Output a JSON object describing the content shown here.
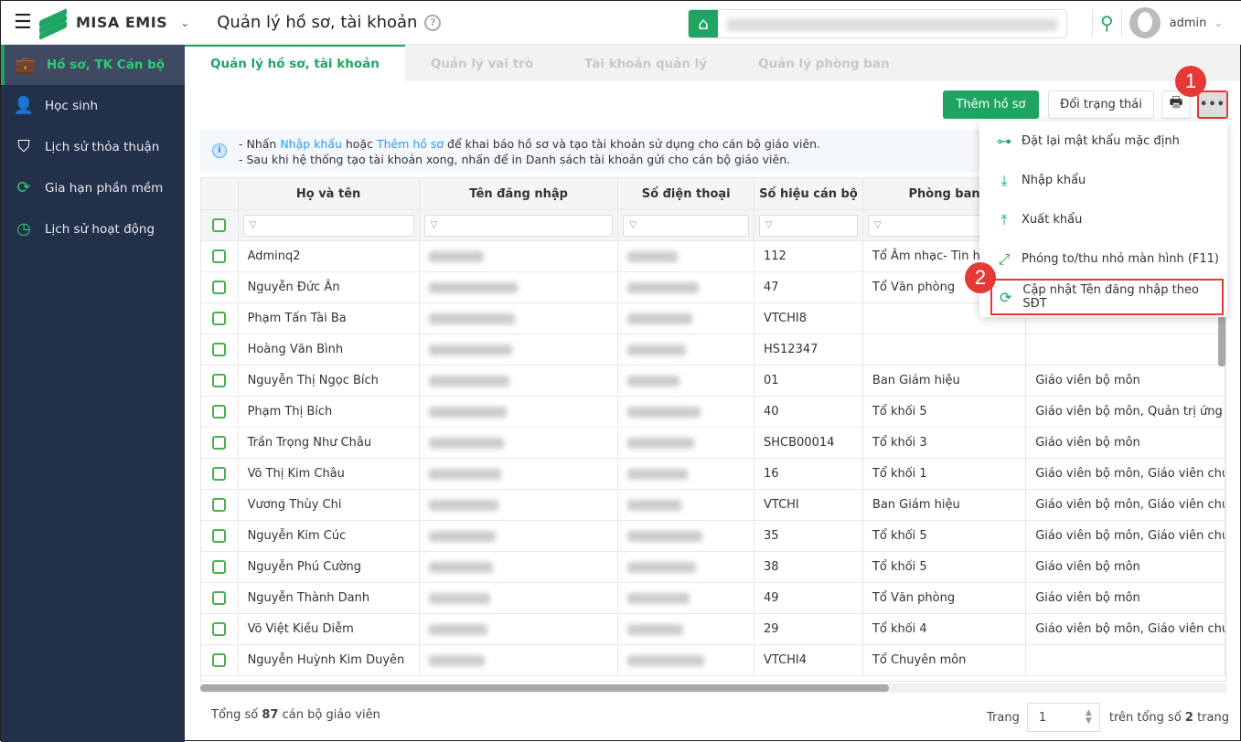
{
  "header": {
    "brand": "MISA EMIS",
    "title": "Quản lý hồ sơ, tài khoản",
    "user": "admin"
  },
  "sidebar": {
    "items": [
      {
        "label": "Hồ sơ, TK Cán bộ",
        "icon": "briefcase-icon",
        "active": true
      },
      {
        "label": "Học sinh",
        "icon": "student-icon"
      },
      {
        "label": "Lịch sử thỏa thuận",
        "icon": "shield-star-icon"
      },
      {
        "label": "Gia hạn phần mềm",
        "icon": "renew-icon"
      },
      {
        "label": "Lịch sử hoạt động",
        "icon": "clock-icon"
      }
    ]
  },
  "tabs": [
    "Quản lý hồ sơ, tài khoản",
    "Quản lý vai trò",
    "Tài khoản quản lý",
    "Quản lý phòng ban"
  ],
  "toolbar": {
    "add": "Thêm hồ sơ",
    "status": "Đổi trạng thái",
    "more": "•••"
  },
  "info": {
    "l1a": "- Nhấn ",
    "l1b": "Nhập khẩu",
    "l1c": " hoặc ",
    "l1d": "Thêm hồ sơ",
    "l1e": " để khai báo hồ sơ và tạo tài khoản sử dụng cho cán bộ giáo viên.",
    "l2": "- Sau khi hệ thống tạo tài khoản xong, nhấn để in Danh sách tài khoản gửi cho cán bộ giáo viên."
  },
  "table": {
    "columns": [
      "Họ và tên",
      "Tên đăng nhập",
      "Số điện thoại",
      "Số hiệu cán bộ",
      "Phòng ban",
      ""
    ],
    "rows": [
      {
        "name": "Adminq2",
        "code": "112",
        "dept": "Tổ Âm nhạc- Tin học",
        "role": ""
      },
      {
        "name": "Nguyễn Đức Ân",
        "code": "47",
        "dept": "Tổ Văn phòng",
        "role": ""
      },
      {
        "name": "Phạm Tấn Tài Ba",
        "code": "VTCHI8",
        "dept": "",
        "role": ""
      },
      {
        "name": "Hoàng Văn Bình",
        "code": "HS12347",
        "dept": "",
        "role": ""
      },
      {
        "name": "Nguyễn Thị Ngọc Bích",
        "code": "01",
        "dept": "Ban Giám hiệu",
        "role": "Giáo viên bộ môn"
      },
      {
        "name": "Phạm Thị Bích",
        "code": "40",
        "dept": "Tổ khối 5",
        "role": "Giáo viên bộ môn, Quản trị ứng"
      },
      {
        "name": "Trần Trọng Như Châu",
        "code": "SHCB00014",
        "dept": "Tổ khối 3",
        "role": "Giáo viên bộ môn"
      },
      {
        "name": "Võ Thị Kim Châu",
        "code": "16",
        "dept": "Tổ khối 1",
        "role": "Giáo viên bộ môn, Giáo viên chủ"
      },
      {
        "name": "Vương Thùy Chi",
        "code": "VTCHI",
        "dept": "Ban Giám hiệu",
        "role": "Giáo viên bộ môn, Giáo viên chủ"
      },
      {
        "name": "Nguyễn Kim Cúc",
        "code": "35",
        "dept": "Tổ khối 5",
        "role": "Giáo viên bộ môn, Giáo viên chủ"
      },
      {
        "name": "Nguyễn Phú Cường",
        "code": "38",
        "dept": "Tổ khối 5",
        "role": "Giáo viên bộ môn"
      },
      {
        "name": "Nguyễn Thành Danh",
        "code": "49",
        "dept": "Tổ Văn phòng",
        "role": "Giáo viên bộ môn"
      },
      {
        "name": "Võ Việt Kiều Diễm",
        "code": "29",
        "dept": "Tổ khối 4",
        "role": "Giáo viên bộ môn, Giáo viên chủ"
      },
      {
        "name": "Nguyễn Huỳnh Kim Duyên",
        "code": "VTCHI4",
        "dept": "Tổ Chuyên môn",
        "role": ""
      }
    ]
  },
  "footer": {
    "pre": "Tổng số ",
    "count": "87",
    "post": " cán bộ giáo viên",
    "page_label": "Trang",
    "page": "1",
    "total_pre": "trên tổng số ",
    "total": "2",
    "total_post": " trang"
  },
  "menu": {
    "items": [
      {
        "label": "Đặt lại mật khẩu mặc định",
        "icon": "key-icon"
      },
      {
        "label": "Nhập khẩu",
        "icon": "import-icon"
      },
      {
        "label": "Xuất khẩu",
        "icon": "export-icon"
      },
      {
        "label": "Phóng to/thu nhỏ màn hình (F11)",
        "icon": "fullscreen-icon"
      },
      {
        "label": "Cập nhật Tên đăng nhập theo SĐT",
        "icon": "refresh-icon"
      }
    ]
  },
  "badges": [
    "1",
    "2"
  ],
  "colors": {
    "accent": "#1fa462",
    "sidebar": "#23304a",
    "highlight": "#e53935"
  }
}
